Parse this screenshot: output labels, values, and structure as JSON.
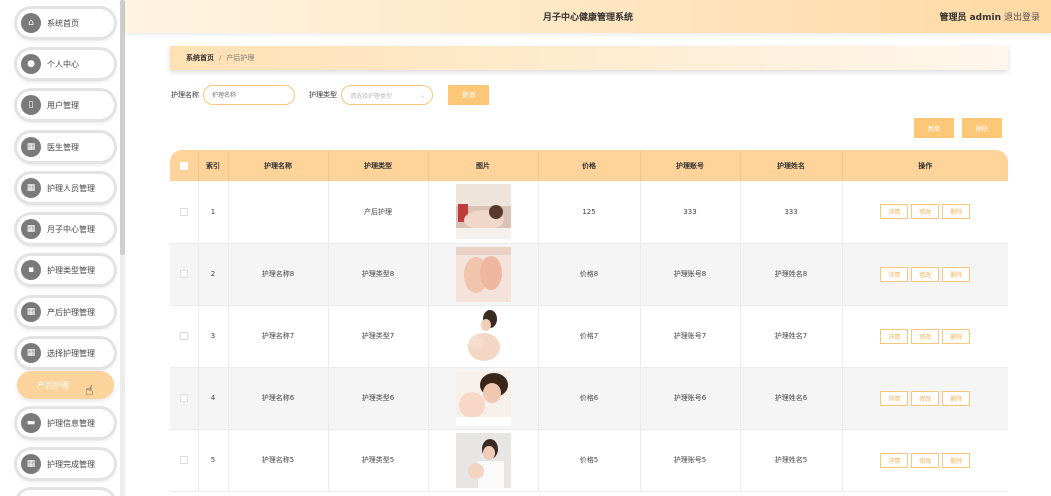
{
  "app_title": "月子中心健康管理系统",
  "header": {
    "user_label": "管理员 admin",
    "logout_label": "退出登录"
  },
  "sidebar": {
    "items": [
      {
        "label": "系统首页",
        "icon": "home-icon"
      },
      {
        "label": "个人中心",
        "icon": "person-icon"
      },
      {
        "label": "用户管理",
        "icon": "phone-icon"
      },
      {
        "label": "医生管理",
        "icon": "grid-icon"
      },
      {
        "label": "护理人员管理",
        "icon": "grid-icon"
      },
      {
        "label": "月子中心管理",
        "icon": "grid-icon"
      },
      {
        "label": "护理类型管理",
        "icon": "chat-icon"
      },
      {
        "label": "产后护理管理",
        "icon": "grid-icon"
      },
      {
        "label": "选择护理管理",
        "icon": "grid-icon"
      },
      {
        "label": "产后护理",
        "icon": "",
        "active": true
      },
      {
        "label": "护理信息管理",
        "icon": "bag-icon"
      },
      {
        "label": "护理完成管理",
        "icon": "grid-icon"
      }
    ]
  },
  "breadcrumb": {
    "home": "系统首页",
    "separator": "/",
    "current": "产后护理"
  },
  "search": {
    "name_label": "护理名称",
    "name_placeholder": "护理名称",
    "type_label": "护理类型",
    "type_placeholder": "请选择护理类型",
    "query_label": "查询"
  },
  "actions": {
    "add_label": "新增",
    "delete_label": "删除"
  },
  "table": {
    "columns": [
      "索引",
      "护理名称",
      "护理类型",
      "图片",
      "价格",
      "护理账号",
      "护理姓名",
      "操作"
    ],
    "op_labels": {
      "detail": "详情",
      "edit": "修改",
      "delete": "删除"
    },
    "rows": [
      {
        "index": "1",
        "name": "",
        "type": "产后护理",
        "image": "massage-photo",
        "price": "125",
        "account": "333",
        "nurse_name": "333"
      },
      {
        "index": "2",
        "name": "护理名称8",
        "type": "护理类型8",
        "image": "baby-feet-photo",
        "price": "价格8",
        "account": "护理账号8",
        "nurse_name": "护理姓名8"
      },
      {
        "index": "3",
        "name": "护理名称7",
        "type": "护理类型7",
        "image": "mother-baby-photo",
        "price": "价格7",
        "account": "护理账号7",
        "nurse_name": "护理姓名7"
      },
      {
        "index": "4",
        "name": "护理名称6",
        "type": "护理类型6",
        "image": "mother-baby-smile-photo",
        "price": "价格6",
        "account": "护理账号6",
        "nurse_name": "护理姓名6"
      },
      {
        "index": "5",
        "name": "护理名称5",
        "type": "护理类型5",
        "image": "mother-holding-baby-photo",
        "price": "价格5",
        "account": "护理账号5",
        "nurse_name": "护理姓名5"
      }
    ]
  },
  "colors": {
    "accent": "#fcc878",
    "header_bg": "#ffd39a",
    "border_accent": "#fcc77a"
  }
}
